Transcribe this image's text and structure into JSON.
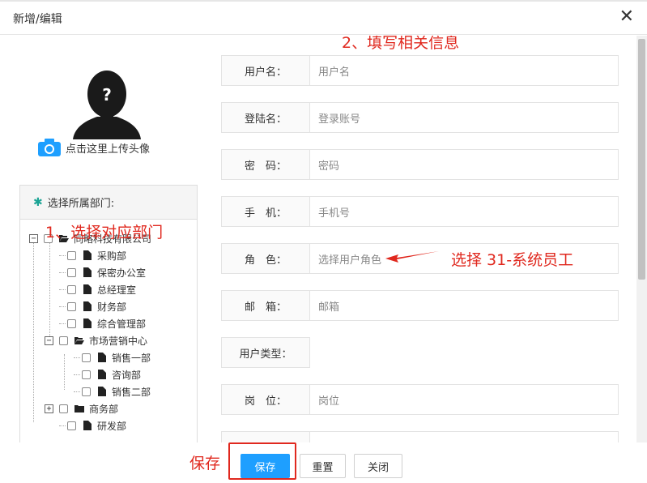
{
  "dialog": {
    "title": "新增/编辑",
    "close_symbol": "✕"
  },
  "avatar": {
    "upload_label": "点击这里上传头像",
    "placeholder_symbol": "?"
  },
  "dept": {
    "header_label": "选择所属部门:",
    "tree": [
      {
        "label": "同略科技有限公司",
        "icon": "folder-open-icon",
        "expander": "−"
      },
      {
        "label": "采购部",
        "icon": "file-icon"
      },
      {
        "label": "保密办公室",
        "icon": "file-icon"
      },
      {
        "label": "总经理室",
        "icon": "file-icon"
      },
      {
        "label": "财务部",
        "icon": "file-icon"
      },
      {
        "label": "综合管理部",
        "icon": "file-icon"
      },
      {
        "label": "市场营销中心",
        "icon": "folder-open-icon",
        "expander": "−"
      },
      {
        "label": "销售一部",
        "icon": "file-icon"
      },
      {
        "label": "咨询部",
        "icon": "file-icon"
      },
      {
        "label": "销售二部",
        "icon": "file-icon"
      },
      {
        "label": "商务部",
        "icon": "folder-icon",
        "expander": "+"
      },
      {
        "label": "研发部",
        "icon": "file-icon"
      }
    ]
  },
  "form": {
    "fields": [
      {
        "label": "用户名：",
        "placeholder": "用户名"
      },
      {
        "label": "登陆名：",
        "placeholder": "登录账号"
      },
      {
        "label": "密　码：",
        "placeholder": "密码"
      },
      {
        "label": "手　机：",
        "placeholder": "手机号"
      },
      {
        "label": "角　色：",
        "placeholder": "选择用户角色"
      },
      {
        "label": "邮　箱：",
        "placeholder": "邮箱"
      },
      {
        "label": "用户类型：",
        "placeholder": ""
      },
      {
        "label": "岗　位：",
        "placeholder": "岗位"
      },
      {
        "label": "",
        "placeholder": ""
      }
    ]
  },
  "annotations": {
    "step1": "1、选择对应部门",
    "step2": "2、填写相关信息",
    "role_hint": "选择 31-系统员工",
    "save_hint": "保存"
  },
  "footer": {
    "save_label": "保存",
    "reset_label": "重置",
    "close_label": "关闭"
  },
  "colors": {
    "accent": "#1e9fff",
    "annotation": "#e0281e",
    "camera": "#1e9fff",
    "palm": "#1aa394"
  }
}
